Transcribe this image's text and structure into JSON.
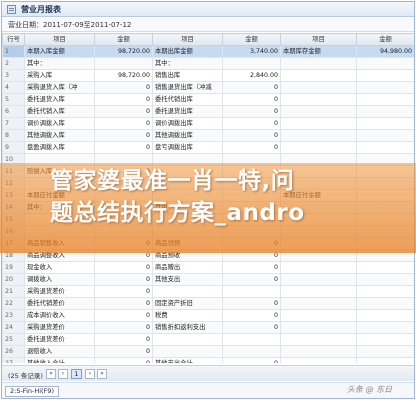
{
  "window": {
    "title": "营业月报表"
  },
  "date_range": "营业日期：2011-07-09至2011-07-12",
  "columns": [
    "行号",
    "项目",
    "金额",
    "项目",
    "金额",
    "项目",
    "金额"
  ],
  "rows": [
    [
      "1",
      "本期入库金额",
      "98,720.00",
      "本期出库金额",
      "3,740.00",
      "本期库存金额",
      "94,980.00"
    ],
    [
      "2",
      "其中：",
      "",
      "其中：",
      "",
      "",
      ""
    ],
    [
      "3",
      "采购入库",
      "98,720.00",
      "销售出库",
      "2,840.00",
      "",
      ""
    ],
    [
      "4",
      "采购退货入库（冲",
      "0",
      "销售退货出库（冲减",
      "0",
      "",
      ""
    ],
    [
      "5",
      "委托退货入库",
      "0",
      "委托代销出库",
      "0",
      "",
      ""
    ],
    [
      "6",
      "委托代销入库",
      "0",
      "委托退货出库",
      "0",
      "",
      ""
    ],
    [
      "7",
      "调价调拨入库",
      "0",
      "调价调拨出库",
      "0",
      "",
      ""
    ],
    [
      "8",
      "其他调拨入库",
      "0",
      "其他调拨出库",
      "0",
      "",
      ""
    ],
    [
      "9",
      "盘盈调拨入库",
      "0",
      "盘亏调拨出库",
      "0",
      "",
      ""
    ],
    [
      "10",
      "",
      "",
      "",
      "",
      "",
      ""
    ],
    [
      "11",
      "赔偿入库",
      "0",
      "",
      "",
      "",
      ""
    ],
    [
      "12",
      "",
      "",
      "",
      "",
      "",
      ""
    ],
    [
      "13",
      "本期应付金额",
      "",
      "",
      "",
      "本期应付余额",
      ""
    ],
    [
      "14",
      "其中：",
      "",
      "其中：",
      "",
      "",
      ""
    ],
    [
      "15",
      "",
      "",
      "",
      "",
      "",
      ""
    ],
    [
      "16",
      "",
      "",
      "",
      "",
      "",
      ""
    ],
    [
      "17",
      "商品销售收入",
      "0",
      "商品领预",
      "0",
      "",
      ""
    ],
    [
      "18",
      "商品调整收入",
      "0",
      "商品预收",
      "0",
      "",
      ""
    ],
    [
      "19",
      "现金收入",
      "0",
      "商品赠出",
      "0",
      "",
      ""
    ],
    [
      "20",
      "调拨收入",
      "0",
      "其他支出",
      "0",
      "",
      ""
    ],
    [
      "21",
      "采购退货差价",
      "0",
      "",
      "",
      "",
      ""
    ],
    [
      "22",
      "委托代销差价",
      "0",
      "固定资产折旧",
      "0",
      "",
      ""
    ],
    [
      "23",
      "成本调价收入",
      "0",
      "税费",
      "0",
      "",
      ""
    ],
    [
      "24",
      "采购退货差价",
      "0",
      "销售折扣返利支出",
      "0",
      "",
      ""
    ],
    [
      "25",
      "委托退货差价",
      "0",
      "",
      "",
      "",
      ""
    ],
    [
      "26",
      "退赔收入",
      "0",
      "",
      "",
      "",
      ""
    ],
    [
      "27",
      "其他收入合计",
      "0",
      "其他支出合计",
      "0",
      "",
      ""
    ]
  ],
  "overlay": {
    "line1": "管家婆最准一肖一特,问",
    "line2": "题总结执行方案_andro"
  },
  "pager": {
    "count": "(25 条记录)",
    "page": "1",
    "first": "«",
    "prev": "‹",
    "next": "›",
    "last": "»"
  },
  "status": {
    "tab": "2:S-Fin-Hi(F9)"
  },
  "watermark": "头条 @ 东日"
}
